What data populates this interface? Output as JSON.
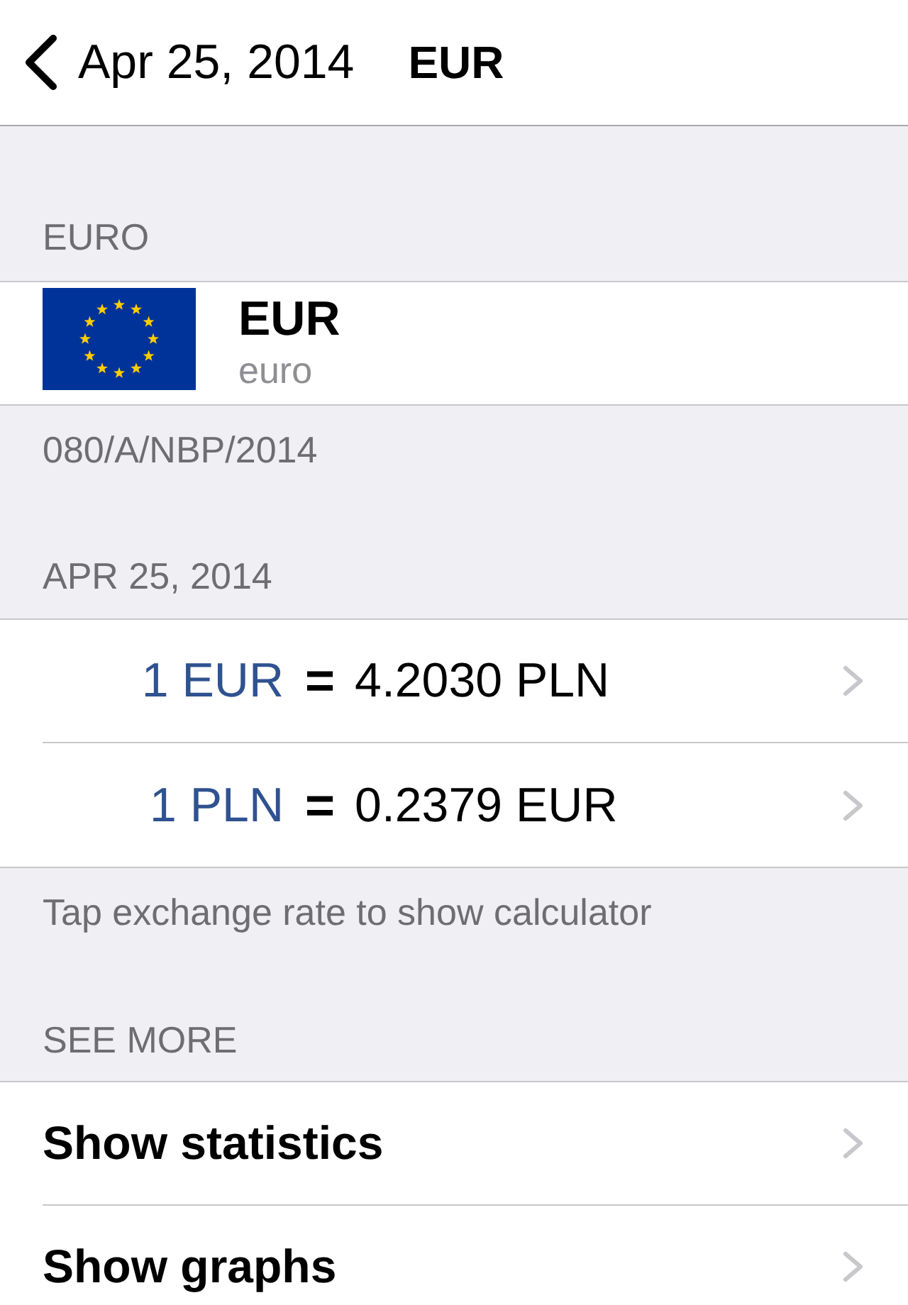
{
  "nav": {
    "back_label": "Apr 25, 2014",
    "title": "EUR"
  },
  "currency": {
    "header": "EURO",
    "code": "EUR",
    "name": "euro",
    "footer": "080/A/NBP/2014"
  },
  "rates": {
    "header": "APR 25, 2014",
    "rows": [
      {
        "from": "1 EUR",
        "sign": "=",
        "to": "4.2030 PLN"
      },
      {
        "from": "1 PLN",
        "sign": "=",
        "to": "0.2379 EUR"
      }
    ],
    "footer": "Tap exchange rate to show calculator"
  },
  "see_more": {
    "header": "SEE MORE",
    "rows": [
      {
        "label": "Show statistics"
      },
      {
        "label": "Show graphs"
      }
    ]
  }
}
